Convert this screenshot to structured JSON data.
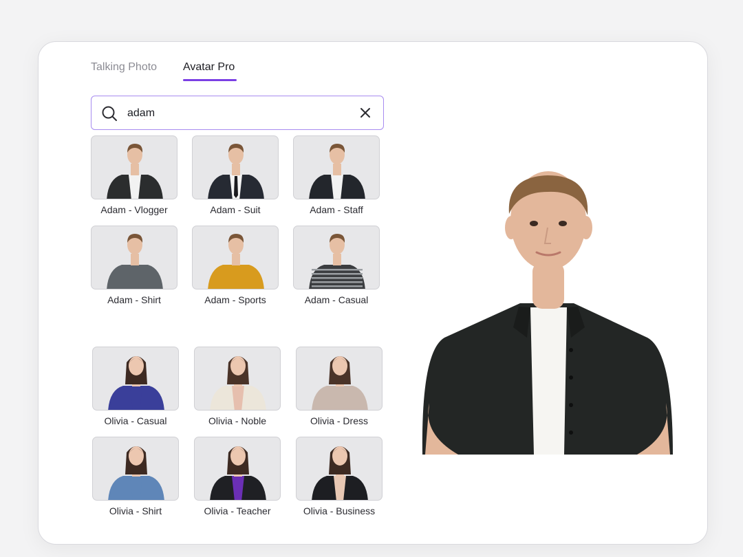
{
  "tabs": [
    {
      "label": "Talking Photo",
      "active": false
    },
    {
      "label": "Avatar Pro",
      "active": true
    }
  ],
  "search": {
    "value": "adam",
    "placeholder": ""
  },
  "avatars": [
    {
      "label": "Adam - Vlogger",
      "outfit": "#2b2d2e",
      "inner": "#f2f2f2",
      "skin": "#e6bfa4",
      "hair": "#7a5638",
      "tie": false
    },
    {
      "label": "Adam - Suit",
      "outfit": "#262a33",
      "inner": "#f4f4f4",
      "skin": "#e6bfa4",
      "hair": "#7a5638",
      "tie": true
    },
    {
      "label": "Adam - Staff",
      "outfit": "#23262c",
      "inner": "#f2f2f2",
      "skin": "#e6bfa4",
      "hair": "#7a5638",
      "tie": false
    },
    {
      "label": "Adam - Shirt",
      "outfit": "#5e6469",
      "inner": "#5e6469",
      "skin": "#e6bfa4",
      "hair": "#7a5638",
      "tie": false
    },
    {
      "label": "Adam - Sports",
      "outfit": "#d89b1e",
      "inner": "#d89b1e",
      "skin": "#e6bfa4",
      "hair": "#7a5638",
      "tie": false
    },
    {
      "label": "Adam - Casual",
      "outfit": "#3b3d40",
      "inner": "#3b3d40",
      "skin": "#e6bfa4",
      "hair": "#7a5638",
      "tie": false
    },
    {
      "label": "Olivia - Casual",
      "outfit": "#3a3f9a",
      "inner": "#3a3f9a",
      "skin": "#ecc7b0",
      "hair": "#3d2a22",
      "tie": false
    },
    {
      "label": "Olivia - Noble",
      "outfit": "#ece6da",
      "inner": "#e6bfae",
      "skin": "#ecc7b0",
      "hair": "#4a3328",
      "tie": false
    },
    {
      "label": "Olivia - Dress",
      "outfit": "#c9b8ae",
      "inner": "#c9b8ae",
      "skin": "#ecc7b0",
      "hair": "#4a3328",
      "tie": false
    },
    {
      "label": "Olivia - Shirt",
      "outfit": "#5f86b8",
      "inner": "#5f86b8",
      "skin": "#ecc7b0",
      "hair": "#3d2a22",
      "tie": false
    },
    {
      "label": "Olivia - Teacher",
      "outfit": "#1f2024",
      "inner": "#6b2fb5",
      "skin": "#ecc7b0",
      "hair": "#3d2a22",
      "tie": false
    },
    {
      "label": "Olivia - Business",
      "outfit": "#1d1e22",
      "inner": "#e8c8b4",
      "skin": "#ecc7b0",
      "hair": "#3d2a22",
      "tie": false
    }
  ],
  "colors": {
    "accent": "#7b3fe4",
    "search_border": "#a78bf0",
    "tile_bg": "#e7e7e9"
  },
  "preview": {
    "shirt": "#232625",
    "tshirt": "#f6f5f2",
    "skin": "#e3b79b",
    "hair": "#8a6440"
  }
}
